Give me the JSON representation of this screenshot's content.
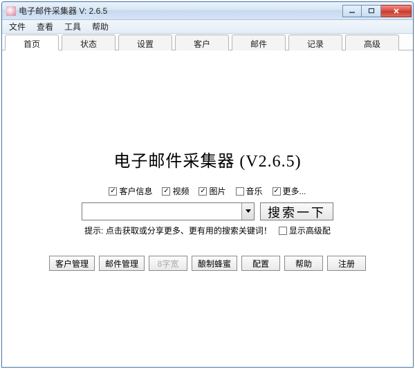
{
  "window": {
    "title": "电子邮件采集器 V: 2.6.5"
  },
  "menu": {
    "file": "文件",
    "view": "查看",
    "tools": "工具",
    "help": "帮助"
  },
  "tabs": [
    {
      "label": "首页",
      "active": true
    },
    {
      "label": "状态",
      "active": false
    },
    {
      "label": "设置",
      "active": false
    },
    {
      "label": "客户",
      "active": false
    },
    {
      "label": "邮件",
      "active": false
    },
    {
      "label": "记录",
      "active": false
    },
    {
      "label": "高级",
      "active": false
    }
  ],
  "main": {
    "title": "电子邮件采集器 (V2.6.5)",
    "checks": [
      {
        "label": "客户信息",
        "checked": true
      },
      {
        "label": "视频",
        "checked": true
      },
      {
        "label": "图片",
        "checked": true
      },
      {
        "label": "音乐",
        "checked": false
      },
      {
        "label": "更多...",
        "checked": true
      }
    ],
    "search_value": "",
    "search_button": "搜索一下",
    "hint": "提示: 点击获取或分享更多、更有用的搜索关键词！",
    "adv_check": {
      "label": "显示高级配",
      "checked": false
    },
    "buttons": [
      {
        "label": "客户管理",
        "disabled": false,
        "name": "customer-manage-button"
      },
      {
        "label": "邮件管理",
        "disabled": false,
        "name": "mail-manage-button"
      },
      {
        "label": "8字宽",
        "disabled": true,
        "name": "width8-button"
      },
      {
        "label": "酿制蜂蜜",
        "disabled": false,
        "name": "make-honey-button"
      },
      {
        "label": "配置",
        "disabled": false,
        "name": "config-button"
      },
      {
        "label": "帮助",
        "disabled": false,
        "name": "help-button"
      },
      {
        "label": "注册",
        "disabled": false,
        "name": "register-button"
      }
    ]
  }
}
